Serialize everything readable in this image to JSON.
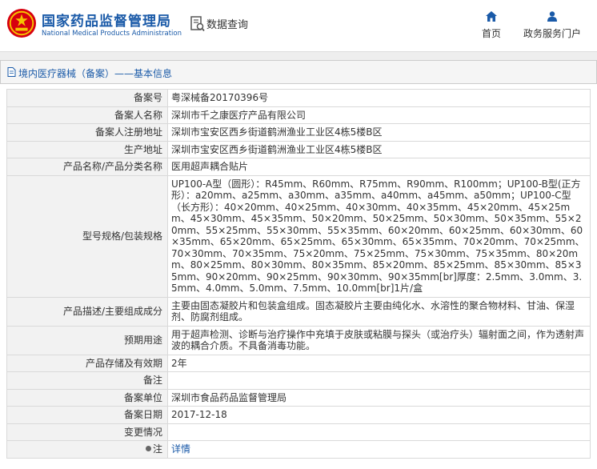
{
  "header": {
    "org_name_cn": "国家药品监督管理局",
    "org_name_en": "National Medical Products Administration",
    "query_label": "数据查询",
    "nav": {
      "home_label": "首页",
      "service_label": "政务服务门户"
    }
  },
  "breadcrumb": {
    "text": "境内医疗器械（备案）——基本信息"
  },
  "fields": [
    {
      "label": "备案号",
      "value": "粤深械备20170396号"
    },
    {
      "label": "备案人名称",
      "value": "深圳市千之康医疗产品有限公司"
    },
    {
      "label": "备案人注册地址",
      "value": "深圳市宝安区西乡街道鹤洲渔业工业区4栋5楼B区"
    },
    {
      "label": "生产地址",
      "value": "深圳市宝安区西乡街道鹤洲渔业工业区4栋5楼B区"
    },
    {
      "label": "产品名称/产品分类名称",
      "value": "医用超声耦合贴片"
    },
    {
      "label": "型号规格/包装规格",
      "value": "UP100-A型（圆形）：R45mm、R60mm、R75mm、R90mm、R100mm；UP100-B型(正方形）：a20mm、a25mm、a30mm、a35mm、a40mm、a45mm、a50mm；UP100-C型（长方形）：40×20mm、40×25mm、40×30mm、40×35mm、45×20mm、45×25mm、45×30mm、45×35mm、50×20mm、50×25mm、50×30mm、50×35mm、55×20mm、55×25mm、55×30mm、55×35mm、60×20mm、60×25mm、60×30mm、60×35mm、65×20mm、65×25mm、65×30mm、65×35mm、70×20mm、70×25mm、70×30mm、70×35mm、75×20mm、75×25mm、75×30mm、75×35mm、80×20mm、80×25mm、80×30mm、80×35mm、85×20mm、85×25mm、85×30mm、85×35mm、90×20mm、90×25mm、90×30mm、90×35mm[br]厚度：2.5mm、3.0mm、3.5mm、4.0mm、5.0mm、7.5mm、10.0mm[br]1片/盒"
    },
    {
      "label": "产品描述/主要组成成分",
      "value": "主要由固态凝胶片和包装盒组成。固态凝胶片主要由纯化水、水溶性的聚合物材料、甘油、保湿剂、防腐剂组成。"
    },
    {
      "label": "预期用途",
      "value": "用于超声检测、诊断与治疗操作中充填于皮肤或粘膜与探头（或治疗头）辐射面之间，作为透射声波的耦合介质。不具备消毒功能。"
    },
    {
      "label": "产品存储及有效期",
      "value": "2年"
    },
    {
      "label": "备注",
      "value": ""
    },
    {
      "label": "备案单位",
      "value": "深圳市食品药品监督管理局"
    },
    {
      "label": "备案日期",
      "value": "2017-12-18"
    },
    {
      "label": "变更情况",
      "value": ""
    }
  ],
  "note_row": {
    "label": "注",
    "link_text": "详情"
  },
  "colors": {
    "brand_blue": "#1a5aa8",
    "label_bg": "#f2f2f2",
    "border": "#d9d9d9",
    "logo_red": "#d7000f"
  },
  "icons": {
    "logo": "emblem-logo",
    "query": "document-search-icon",
    "home": "home-icon",
    "service": "user-icon",
    "breadcrumb": "document-icon",
    "note": "pin-icon"
  }
}
